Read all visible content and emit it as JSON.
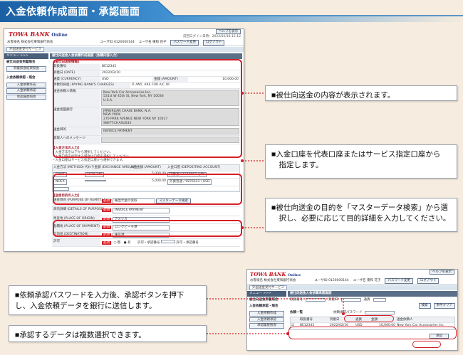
{
  "banner": {
    "title": "入金依頼作成画面・承認画面"
  },
  "screen1": {
    "logo_main": "TOWA BANK",
    "logo_sub": "Online",
    "help_button": "ヘルプを表示",
    "last_login": "前回ログイン日時：2022/02/18 15:12",
    "customer": "お客様名 株式会社東和銀行商会",
    "user_id": "ユーザID 0120000144",
    "user_name": "ユーザ名 東和 花子",
    "password_change": "パスワード変更",
    "logout": "ログアウト",
    "tab_label": "外国送金受付サービス",
    "menu_header": "メニュー >>>",
    "sidebar": [
      {
        "heading": "被仕向送金到着照会",
        "button": "到着照会結果照会"
      },
      {
        "heading": "入金依頼承認・照会",
        "buttons": [
          "入金依頼作成",
          "入金依頼承認",
          "承認履歴照会"
        ]
      }
    ],
    "main_title": "被仕向送金入金依頼作成画面（依頼内容入力）",
    "info_header": "【被仕向送金情報】",
    "info_rows": [
      {
        "label": "取扱番号",
        "value": "BE12345"
      },
      {
        "label": "到着日 (DATE)",
        "value": "2022/02/10"
      },
      {
        "label": "通貨 (CURRENCY)",
        "value": "USD"
      },
      {
        "label": "手数料負担 (PAYING BANK'S CHARGES)",
        "value": "IF ANY, ARE FOR A/C OF"
      }
    ],
    "amount_label": "金額 (AMOUNT)",
    "amount_value": "10,000.00",
    "beneficiary_label": "送金依頼人情報",
    "beneficiary_value": [
      "New York Car Accessories Inc.",
      "531st W 45th St, New York, NY 10036",
      "U.S.A."
    ],
    "remitting_bank_label": "送金指図銀行",
    "remitting_bank_value": [
      "JPMORGAN CHASE BANK, N.A.",
      "NEW YORK",
      "270 PARK AVENUE NEW YORK NY 10017",
      "SWIFT:CHASUS33"
    ],
    "purpose_label": "送金目的",
    "purpose_value": "INVOICE PAYMENT",
    "message_label": "受取人へのメッセージ",
    "note_header": "【入金方法の入力】",
    "note_lines": [
      "・入金方法を以下から選択してください。",
      "・入金口座を指定する場合は口座を選択してください。",
      "・入金口座はサービス指定口座から選択できます。"
    ],
    "account_headers": [
      "入金方法 (METHOD)",
      "代わり金額 (EXCHANGE AMOUNT)",
      "入金金額 (AMOUNT)",
      "入金口座 (DEPOSITING ACCOUNT)"
    ],
    "account_rows": [
      {
        "method": "CONT",
        "rate": "1610.345",
        "amount": "5,000.00",
        "account": "円普通 / 1234567 / JPY"
      },
      {
        "method": "NOEX",
        "rate": "",
        "amount": "5,000.00",
        "account": "外貨普通 / 9876543 / USD"
      },
      {
        "method": "",
        "rate": "",
        "amount": "",
        "account": ""
      }
    ],
    "purpose_section_header": "【送金目的の入力】",
    "purpose_rows": [
      {
        "label": "送金目的 (PURPOSE OF REMITTANCE)",
        "value": "輸出代金の受取",
        "button": "マスターデータ検索"
      },
      {
        "label": "目的詳細 (DETAILS OF PURPOSE)",
        "value": "INVOICE PAYMENT"
      },
      {
        "label": "原産地 (PLACE OF ORIGIN)",
        "value": "アメリカ"
      },
      {
        "label": "船積地 (PLACE OF SHIPMENT)",
        "value": "ロングビーチ港"
      },
      {
        "label": "仕向地 (DESTINATION)",
        "value": "東京港"
      }
    ],
    "approval_label": "許可",
    "required_label": "必須",
    "radio_options": [
      "無",
      "有"
    ],
    "permit_fields": [
      "許可・承認番号",
      "許可・承認番号"
    ]
  },
  "screen2": {
    "logo_main": "TOWA BANK",
    "logo_sub": "Online",
    "help_button": "ヘルプを表示",
    "customer": "お客様名 株式会社東和銀行商会",
    "user_id": "ユーザID 0120000144",
    "user_name": "ユーザ名 東和 花子",
    "password_change": "パスワード変更",
    "logout": "ログアウト",
    "tab_label": "外国送金受付サービス",
    "menu_header": "メニュー >>>",
    "sidebar": [
      "被仕向送金到着照会",
      "入金依頼承認・照会"
    ],
    "sidebar_buttons": [
      "入金依頼作成",
      "入金依頼承認",
      "承認履歴照会"
    ],
    "main_title": "被仕向送金入金依頼承認画面",
    "filter_labels": [
      "取扱番号",
      "到着日",
      "通貨"
    ],
    "search_button": "検索",
    "clear_button": "条件クリア",
    "approval_password_label": "依頼承認パスワード",
    "list_label": "依頼一覧",
    "table_headers": [
      "",
      "取扱番号",
      "到着日",
      "通貨",
      "金額",
      "送金依頼人"
    ],
    "table_row": {
      "ref": "BE12345",
      "date": "2022/02/10",
      "currency": "USD",
      "amount": "10,000.00",
      "sender": "New York Car Accessories Inc."
    },
    "approve_button": "承認"
  },
  "callouts": [
    {
      "lines": [
        "■被仕向送金の内容が表示されます。"
      ]
    },
    {
      "lines": [
        "■入金口座を代表口座またはサービス指定口座から",
        "　指定します。"
      ]
    },
    {
      "lines": [
        "■被仕向送金の目的を「マスターデータ検索」から選",
        "　択し、必要に応じて目的詳細を入力してください。"
      ]
    },
    {
      "lines": [
        "■依頼承認パスワードを入力後、承認ボタンを押下",
        "し、入金依頼データを銀行に送信します。"
      ]
    },
    {
      "lines": [
        "■承認するデータは複数選択できます。"
      ]
    }
  ],
  "colors": {
    "accent_red": "#d61f26",
    "banner_blue": "#1f6fb2",
    "background": "#f6ecdf"
  }
}
